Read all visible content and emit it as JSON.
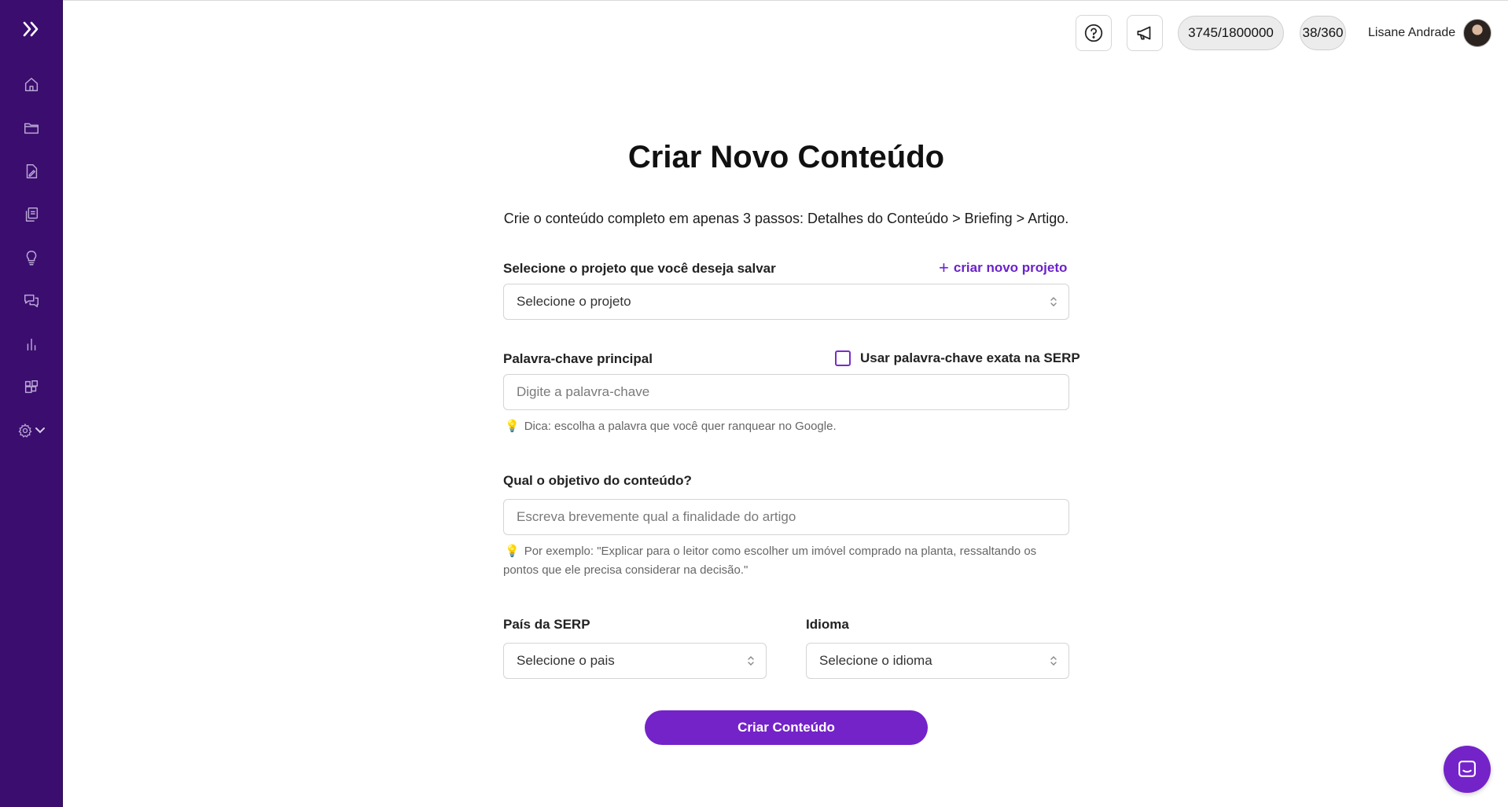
{
  "header": {
    "credits_words": "3745/1800000",
    "credits_articles": "38/360",
    "user_name": "Lisane Andrade"
  },
  "sidebar": {
    "items": [
      {
        "icon": "home-icon"
      },
      {
        "icon": "folder-icon"
      },
      {
        "icon": "document-edit-icon"
      },
      {
        "icon": "documents-copy-icon"
      },
      {
        "icon": "lightbulb-icon"
      },
      {
        "icon": "chat-bubbles-icon"
      },
      {
        "icon": "bar-chart-icon"
      },
      {
        "icon": "apps-grid-icon"
      }
    ],
    "settings_icon": "gear-icon"
  },
  "form": {
    "title": "Criar Novo Conteúdo",
    "subtitle": "Crie o conteúdo completo em apenas 3 passos: Detalhes do Conteúdo > Briefing > Artigo.",
    "project_label": "Selecione o projeto que você deseja salvar",
    "new_project_plus": "+",
    "new_project_link": "criar novo projeto",
    "project_select": "Selecione o projeto",
    "keyword_label": "Palavra-chave principal",
    "exact_keyword_label": "Usar palavra-chave exata na SERP",
    "keyword_placeholder": "Digite a palavra-chave",
    "keyword_hint": "Dica: escolha a palavra que você quer ranquear no Google.",
    "objective_label": "Qual o objetivo do conteúdo?",
    "objective_placeholder": "Escreva brevemente qual a finalidade do artigo",
    "objective_hint_line1": "Por exemplo: \"Explicar para o leitor como escolher um imóvel comprado na planta, ressaltando os",
    "objective_hint_line2": "pontos que ele precisa considerar na decisão.\"",
    "country_label": "País da SERP",
    "country_select": "Selecione o pais",
    "language_label": "Idioma",
    "language_select": "Selecione o idioma",
    "submit_label": "Criar Conteúdo"
  },
  "colors": {
    "sidebar": "#3b0d6e",
    "accent": "#7423c9",
    "link": "#6b22c9"
  }
}
